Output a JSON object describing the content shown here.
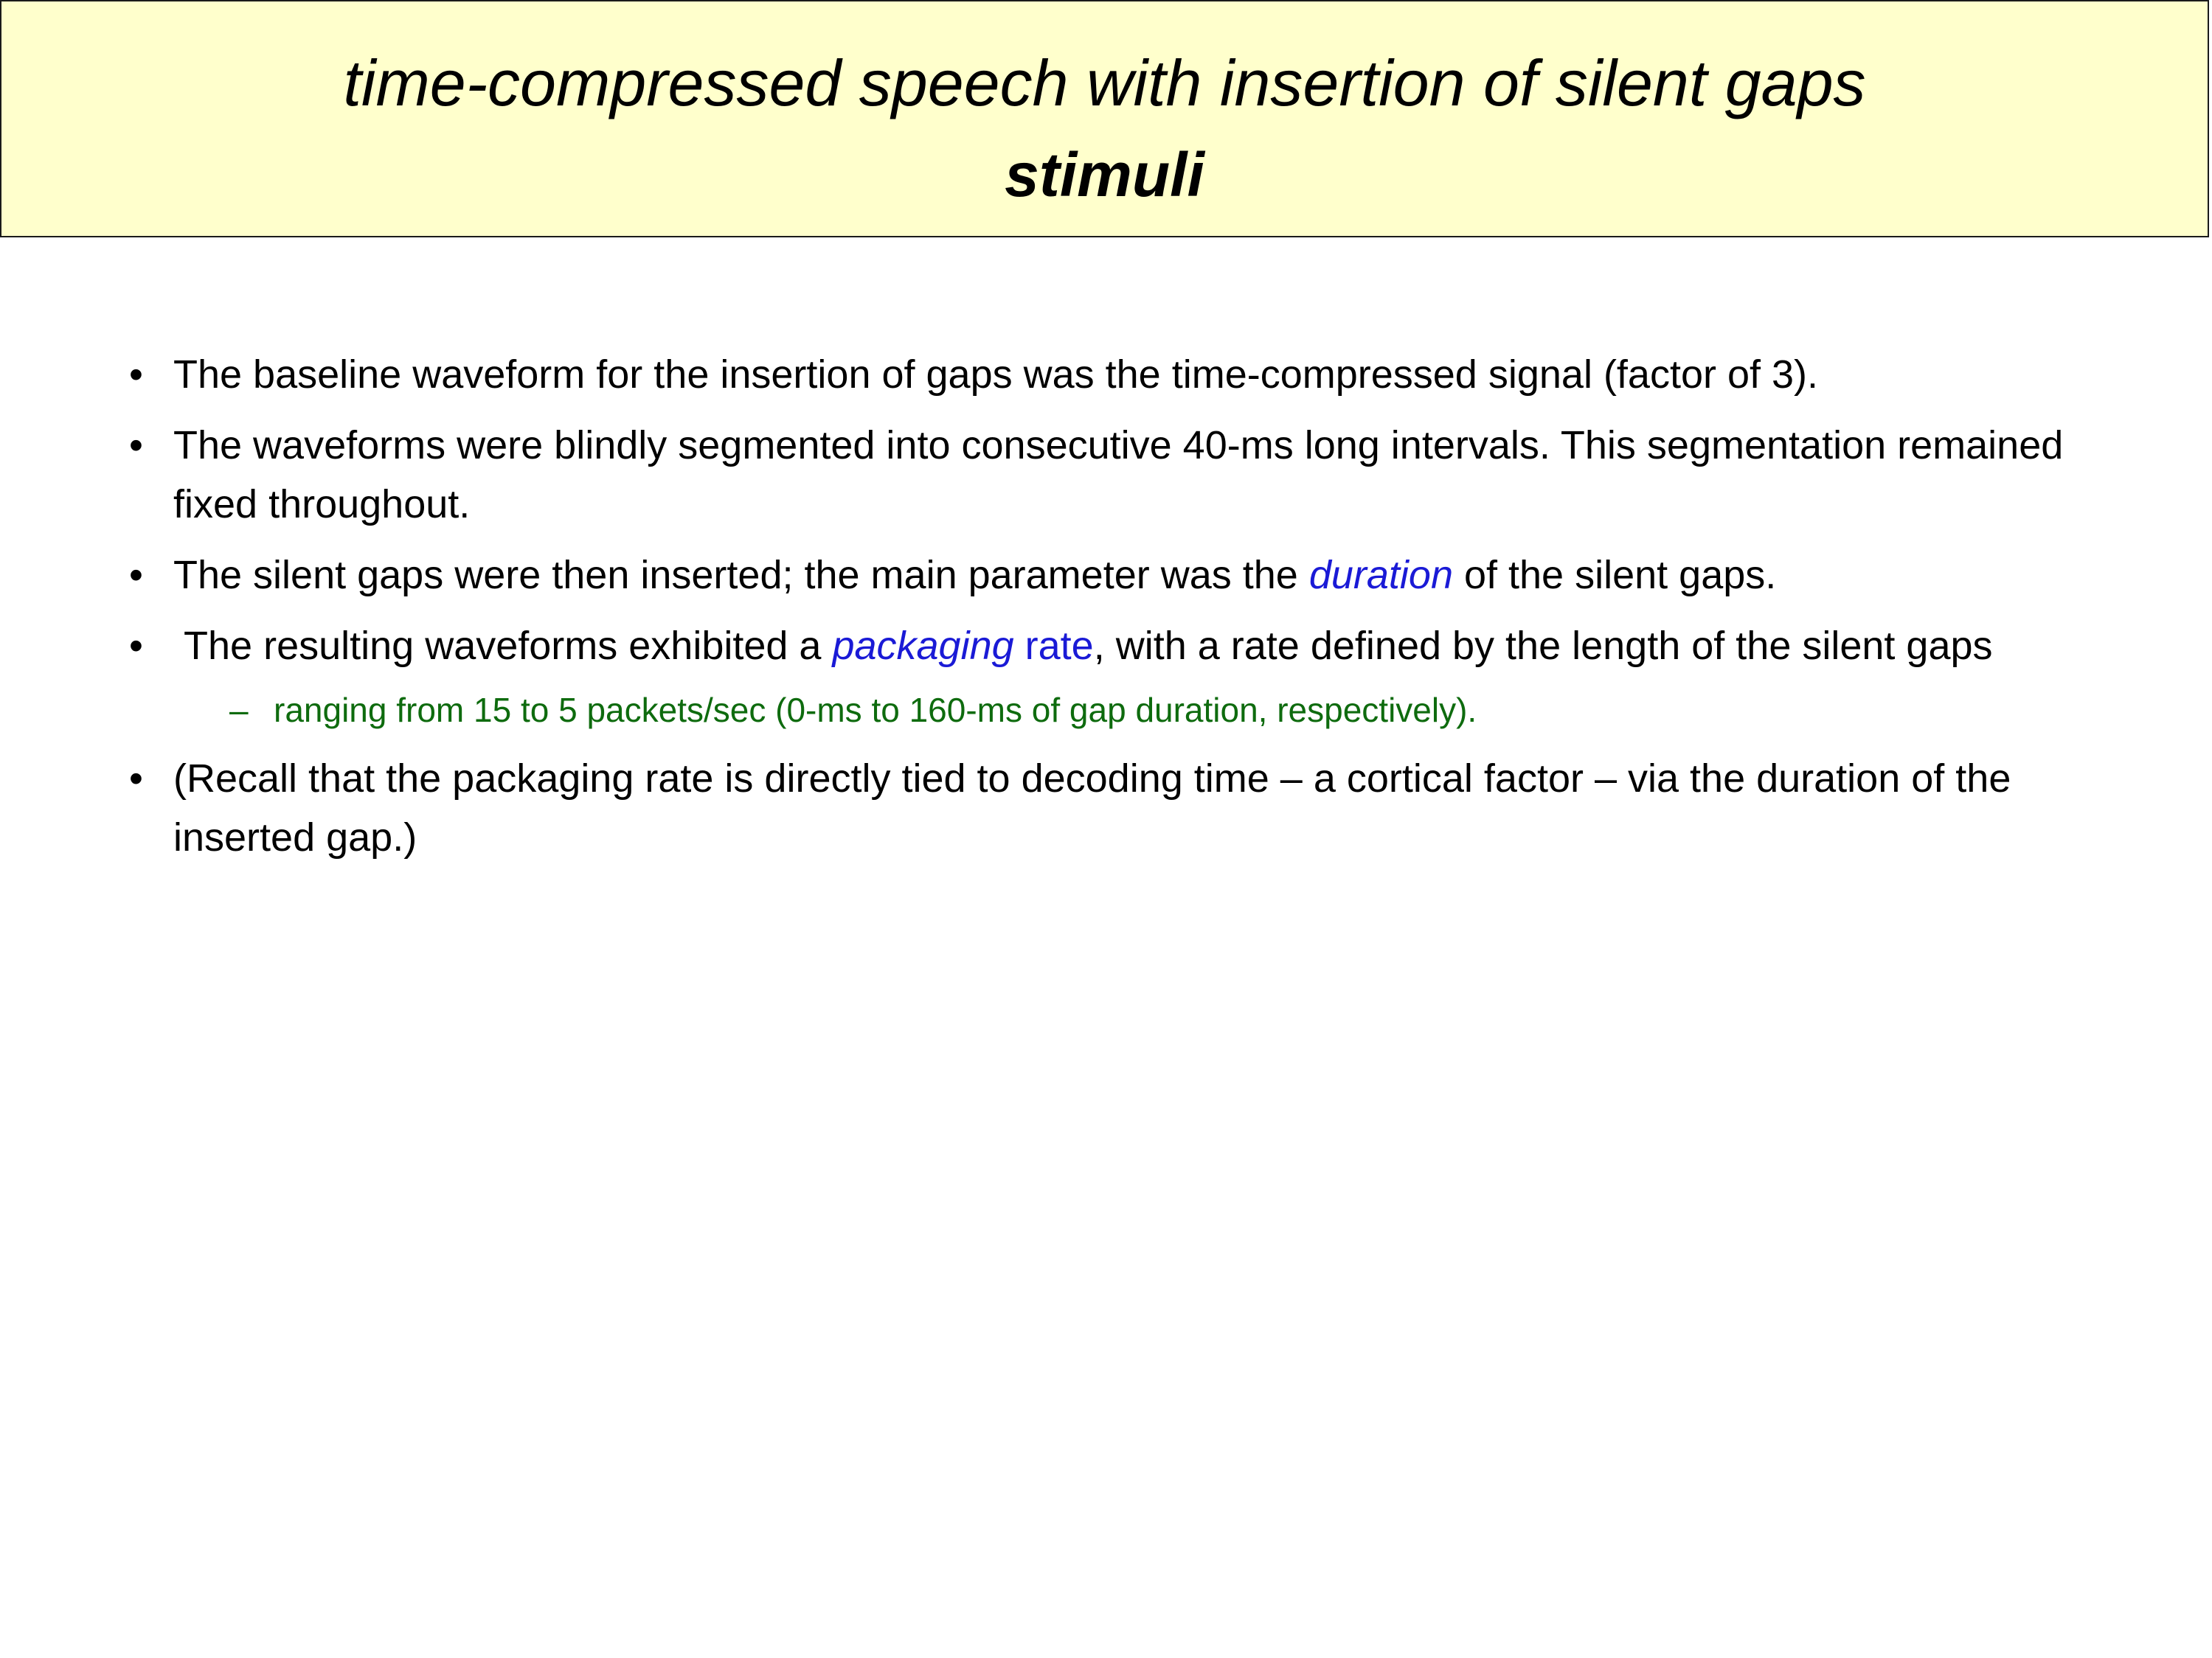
{
  "title": {
    "line1": "time-compressed speech with insertion of silent gaps",
    "line2": "stimuli"
  },
  "bullets": [
    {
      "text": "The baseline waveform for the insertion of gaps was the time-compressed signal (factor of 3)."
    },
    {
      "text": "The waveforms were blindly segmented into consecutive 40-ms long intervals. This segmentation remained fixed throughout."
    },
    {
      "before": "The silent gaps were then inserted; the main parameter was the ",
      "highlight": "duration",
      "after": " of the silent gaps."
    },
    {
      "before": " The resulting waveforms exhibited a ",
      "highlight": "packaging",
      "highlight2": " rate",
      "after": ", with a rate defined by the length of the silent gaps"
    },
    {
      "text": "(Recall that the packaging rate is directly tied to decoding time – a cortical factor – via the duration of the inserted gap.)"
    }
  ],
  "sub_bullet": {
    "dash": "–",
    "text": "ranging from 15 to 5 packets/sec (0-ms to 160-ms of gap duration, respectively)."
  },
  "bullet_symbol": "•",
  "colors": {
    "title_bg": "#ffffcc",
    "highlight": "#1a1ad6",
    "sub_text": "#0e6b0e"
  }
}
